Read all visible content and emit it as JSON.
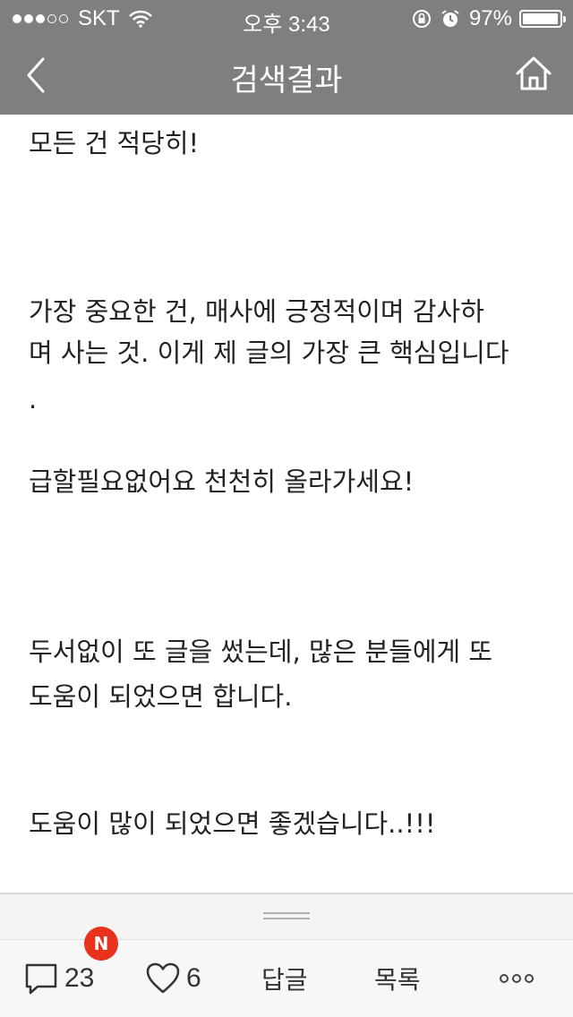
{
  "status_bar": {
    "carrier": "SKT",
    "time": "오후 3:43",
    "battery": "97%",
    "battery_level": 0.97
  },
  "nav": {
    "title": "검색결과",
    "back_icon": "chevron-left-icon",
    "home_icon": "home-icon"
  },
  "article": {
    "paragraphs": [
      "모든 건 적당히!",
      "가장 중요한 건, 매사에 긍정적이며 감사하",
      "며 사는 것. 이게 제 글의 가장 큰 핵심입니다",
      ".",
      "급할필요없어요 천천히 올라가세요!",
      "두서없이 또 글을 썼는데, 많은 분들에게 또",
      "도움이 되었으면 합니다.",
      "도움이 많이 되었으면 좋겠습니다..!!!"
    ]
  },
  "toolbar": {
    "comments_count": "23",
    "badge": "N",
    "likes_count": "6",
    "reply_label": "답글",
    "list_label": "목록"
  },
  "colors": {
    "header_bg": "#7f7f7f",
    "badge_bg": "#e8321b"
  }
}
